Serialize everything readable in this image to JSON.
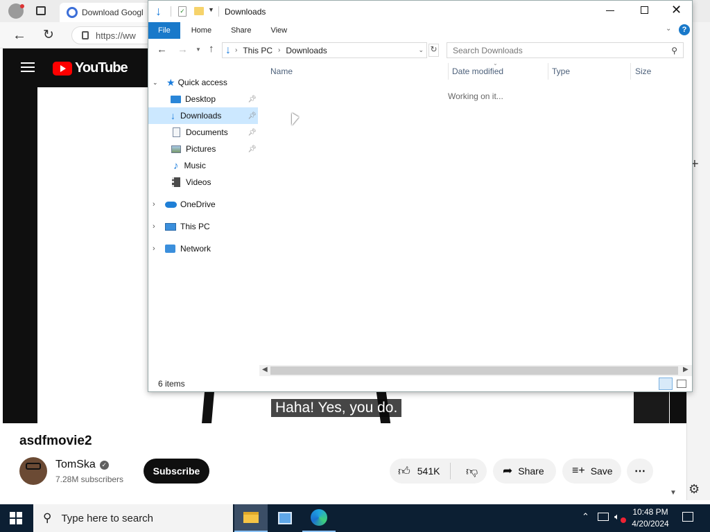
{
  "browser": {
    "tab_title": "Download Googl",
    "url": "https://ww"
  },
  "youtube": {
    "logo_text": "YouTube",
    "caption": "Haha! Yes, you do.",
    "video_title": "asdfmovie2",
    "channel_name": "TomSka",
    "subscribers": "7.28M subscribers",
    "subscribe_label": "Subscribe",
    "like_count": "541K",
    "share_label": "Share",
    "save_label": "Save"
  },
  "explorer": {
    "window_title": "Downloads",
    "ribbon_tabs": [
      "File",
      "Home",
      "Share",
      "View"
    ],
    "breadcrumb": [
      "This PC",
      "Downloads"
    ],
    "search_placeholder": "Search Downloads",
    "quick_access_label": "Quick access",
    "quick_access_items": [
      {
        "label": "Desktop",
        "icon": "desktop-icon",
        "pinned": true
      },
      {
        "label": "Downloads",
        "icon": "download-folder-icon",
        "pinned": true,
        "selected": true
      },
      {
        "label": "Documents",
        "icon": "documents-icon",
        "pinned": true
      },
      {
        "label": "Pictures",
        "icon": "pictures-icon",
        "pinned": true
      },
      {
        "label": "Music",
        "icon": "music-icon",
        "pinned": false
      },
      {
        "label": "Videos",
        "icon": "videos-icon",
        "pinned": false
      }
    ],
    "roots": [
      {
        "label": "OneDrive",
        "icon": "onedrive-icon"
      },
      {
        "label": "This PC",
        "icon": "this-pc-icon"
      },
      {
        "label": "Network",
        "icon": "network-icon"
      }
    ],
    "columns": [
      "Name",
      "Date modified",
      "Type",
      "Size"
    ],
    "loading_text": "Working on it...",
    "item_count": "6 items"
  },
  "taskbar": {
    "search_placeholder": "Type here to search",
    "time": "10:48 PM",
    "date": "4/20/2024"
  },
  "colors": {
    "explorer_accent": "#1979ca",
    "selection": "#cce8ff",
    "youtube_red": "#ff0000",
    "taskbar_bg": "#0c1f33"
  }
}
